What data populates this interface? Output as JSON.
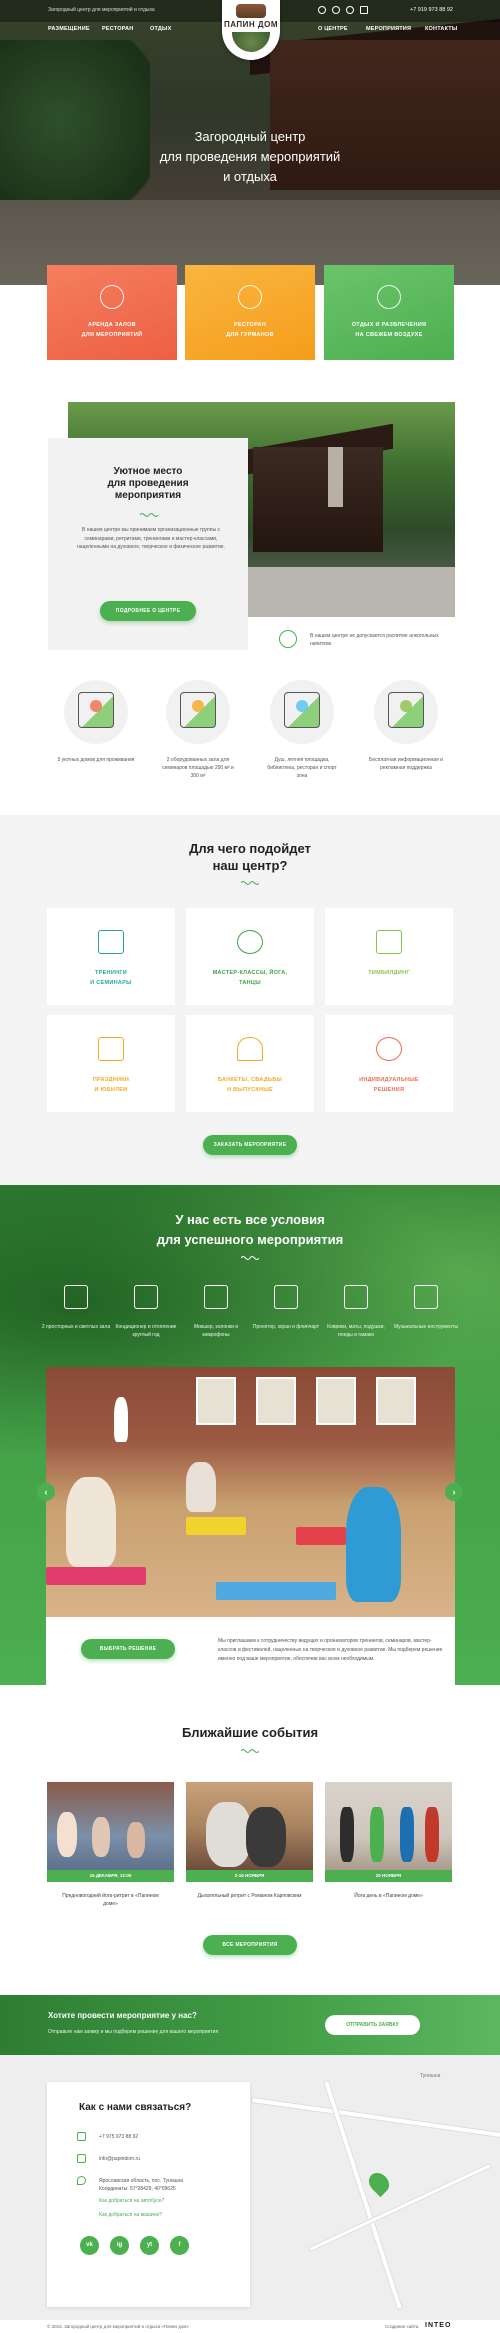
{
  "header": {
    "tagline": "Загородный центр для мероприятий и отдыха",
    "phone": "+7 919 973 88 92",
    "logo_text": "ПАПИН ДОМ",
    "nav_left": [
      "РАЗМЕЩЕНИЕ",
      "РЕСТОРАН",
      "ОТДЫХ"
    ],
    "nav_right": [
      "О ЦЕНТРЕ",
      "МЕРОПРИЯТИЯ",
      "КОНТАКТЫ"
    ],
    "social_icons": [
      "vk-icon",
      "instagram-icon",
      "youtube-icon",
      "facebook-icon"
    ]
  },
  "hero": {
    "title_line1": "Загородный центр",
    "title_line2": "для проведения мероприятий",
    "title_line3": "и отдыха"
  },
  "features": [
    {
      "line1": "АРЕНДА ЗАЛОВ",
      "line2": "ДЛЯ МЕРОПРИЯТИЙ",
      "color": "#f06d4f"
    },
    {
      "line1": "РЕСТОРАН",
      "line2": "ДЛЯ ГУРМАНОВ",
      "color": "#f7a823"
    },
    {
      "line1": "ОТДЫХ И РАЗВЛЕЧЕНИЯ",
      "line2": "НА СВЕЖЕМ ВОЗДУХЕ",
      "color": "#5cb85c"
    }
  ],
  "about": {
    "title_line1": "Уютное место",
    "title_line2": "для проведения",
    "title_line3": "мероприятия",
    "text": "В нашем центре мы принимаем организационные группы с семинарами, ретритами, тренингами и мастер-классами, нацеленными на духовное, творческое и физическое развитие.",
    "button": "ПОДРОБНЕЕ О ЦЕНТРЕ",
    "note": "В нашем центре не допускается распитие алкогольных напитков"
  },
  "amenities": [
    "5 уютных домов для проживания",
    "2 оборудованных зала для семинаров площадью 200 м² и 300 м²",
    "Душ, летняя площадка, библиотека, ресторан и спорт зона",
    "Бесплатная информационная и рекламная поддержка"
  ],
  "forwhat": {
    "title_line1": "Для чего подойдет",
    "title_line2": "наш центр?",
    "tiles": [
      {
        "line1": "ТРЕНИНГИ",
        "line2": "И СЕМИНАРЫ",
        "color": "#26a69a"
      },
      {
        "line1": "МАСТЕР-КЛАССЫ, ЙОГА,",
        "line2": "ТАНЦЫ",
        "color": "#43a047"
      },
      {
        "line1": "ТИМБИЛДИНГ",
        "line2": "",
        "color": "#8bc34a"
      },
      {
        "line1": "ПРАЗДНИКИ",
        "line2": "И ЮБИЛЕИ",
        "color": "#f7a823"
      },
      {
        "line1": "БАНКЕТЫ, СВАДЬБЫ",
        "line2": "И ВЫПУСКНЫЕ",
        "color": "#f7a823"
      },
      {
        "line1": "ИНДИВИДУАЛЬНЫЕ",
        "line2": "РЕШЕНИЯ",
        "color": "#f06d4f"
      }
    ],
    "button": "ЗАКАЗАТЬ МЕРОПРИЯТИЕ"
  },
  "conditions": {
    "title_line1": "У нас есть все условия",
    "title_line2": "для успешного мероприятия",
    "items": [
      "2 просторных и светлых зала",
      "Кондиционер и отопление круглый год",
      "Микшер, колонки и микрофоны",
      "Проектор, экран и флипчарт",
      "Коврики, маты, подушки, пледы и гамаки",
      "Музыкальные инструменты"
    ],
    "button": "ВЫБРАТЬ РЕШЕНИЕ",
    "text": "Мы приглашаем к сотрудничеству ведущих и организаторов тренингов, семинаров, мастер-классов и фестивалей, нацеленных на творческое и духовное развитие. Мы подберем решение именно под ваше мероприятие, обеспечив вас всем необходимым."
  },
  "events": {
    "title": "Ближайшие события",
    "items": [
      {
        "date": "15 ДЕКАБРЯ, 12:00",
        "title": "Предновогодний йога-ритрит в «Папином доме»"
      },
      {
        "date": "2-16 НОЯБРЯ",
        "title": "Дыхательный ретрит с Романом Карповским"
      },
      {
        "date": "20 НОЯБРЯ",
        "title": "Йога день в «Папином доме»"
      }
    ],
    "button": "ВСЕ МЕРОПРИЯТИЯ"
  },
  "cta": {
    "title": "Хотите провести мероприятие у нас?",
    "text": "Отправьте нам заявку и мы подберем решение для вашего мероприятия",
    "button": "ОТПРАВИТЬ ЗАЯВКУ"
  },
  "contacts": {
    "title": "Как с нами связаться?",
    "phone": "+7 975 973 88 92",
    "email": "info@papindom.ru",
    "address_line1": "Ярославская область, пос. Туношна",
    "address_line2": "Координаты: 57°28429, 40°09625",
    "link_bus": "Как добраться на автобусе?",
    "link_car": "Как добраться на машине?",
    "social": [
      "vk",
      "ig",
      "yt",
      "f"
    ],
    "map_label": "Туношна"
  },
  "footer": {
    "copyright": "© 2015. Загородный центр для мероприятий и отдыха «Папин дом»",
    "created": "Создание сайта",
    "brand": "INTEO"
  }
}
